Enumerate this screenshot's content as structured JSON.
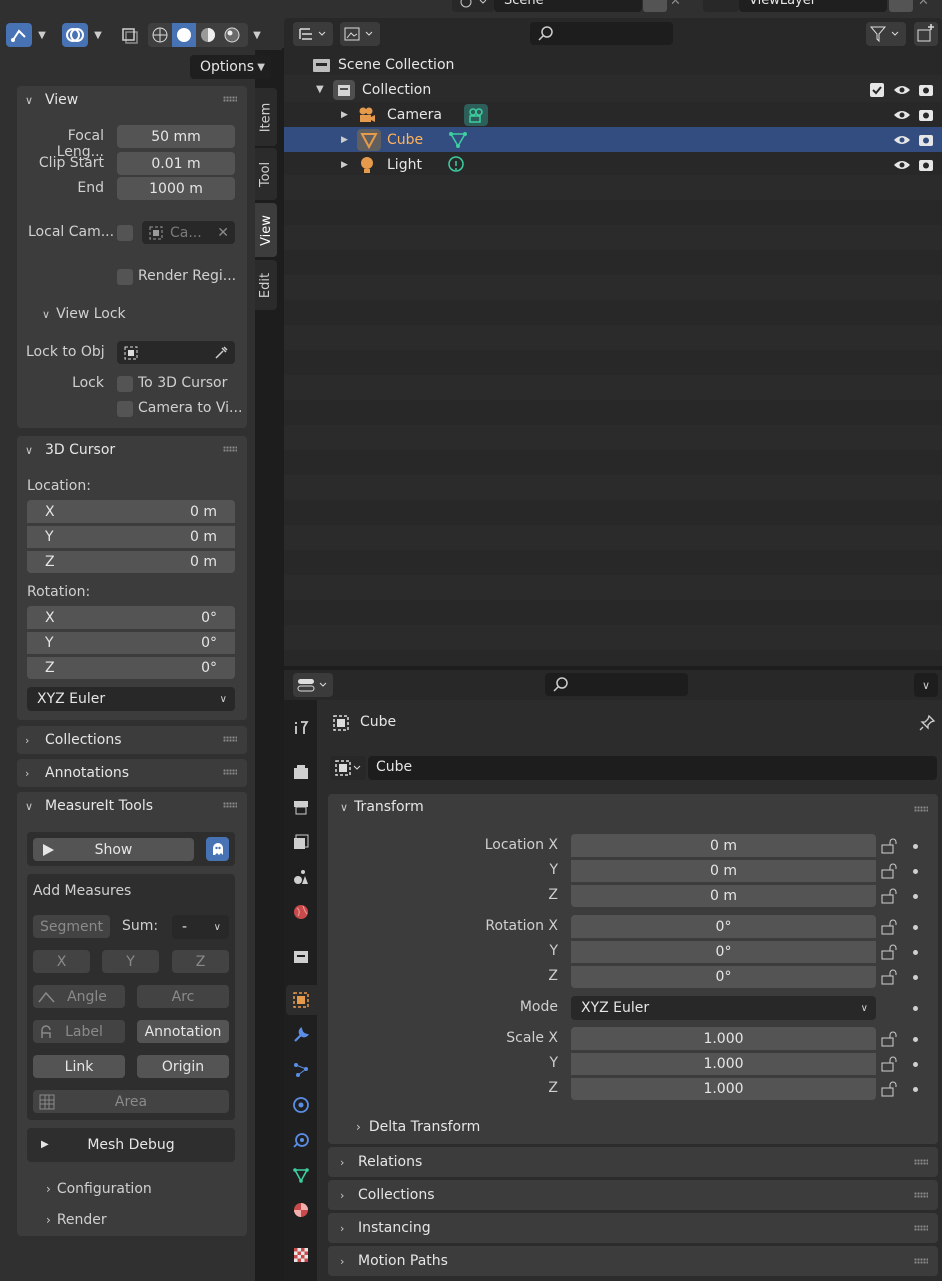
{
  "viewport": {
    "options_label": "Options"
  },
  "side_tabs": [
    "Item",
    "Tool",
    "View",
    "Edit"
  ],
  "view_panel": {
    "title": "View",
    "focal_length_label": "Focal Leng...",
    "focal_length_value": "50 mm",
    "clip_start_label": "Clip Start",
    "clip_start_value": "0.01 m",
    "clip_end_label": "End",
    "clip_end_value": "1000 m",
    "local_camera_label": "Local Cam...",
    "local_camera_field": "Ca...",
    "render_region_label": "Render Regi...",
    "view_lock_title": "View Lock",
    "lock_to_obj_label": "Lock to Obj",
    "lock_label": "Lock",
    "to_3d_cursor_label": "To 3D Cursor",
    "camera_to_view_label": "Camera to Vi..."
  },
  "cursor_panel": {
    "title": "3D Cursor",
    "location_label": "Location:",
    "location": [
      {
        "axis": "X",
        "value": "0 m"
      },
      {
        "axis": "Y",
        "value": "0 m"
      },
      {
        "axis": "Z",
        "value": "0 m"
      }
    ],
    "rotation_label": "Rotation:",
    "rotation": [
      {
        "axis": "X",
        "value": "0°"
      },
      {
        "axis": "Y",
        "value": "0°"
      },
      {
        "axis": "Z",
        "value": "0°"
      }
    ],
    "rotation_mode": "XYZ Euler"
  },
  "collapsed_panels": {
    "collections": "Collections",
    "annotations": "Annotations"
  },
  "measureit": {
    "title": "MeasureIt Tools",
    "show_label": "Show",
    "add_measures_title": "Add Measures",
    "segment_label": "Segment",
    "sum_label": "Sum:",
    "sum_value": "-",
    "x_label": "X",
    "y_label": "Y",
    "z_label": "Z",
    "angle_label": "Angle",
    "arc_label": "Arc",
    "label_label": "Label",
    "annotation_label": "Annotation",
    "link_label": "Link",
    "origin_label": "Origin",
    "area_label": "Area",
    "mesh_debug_label": "Mesh Debug",
    "configuration_label": "Configuration",
    "render_label": "Render"
  },
  "top_bar": {
    "scene_name": "Scene",
    "view_layer_name": "ViewLayer"
  },
  "outliner": {
    "scene_collection": "Scene Collection",
    "collection": "Collection",
    "items": [
      {
        "name": "Camera",
        "selected": false
      },
      {
        "name": "Cube",
        "selected": true
      },
      {
        "name": "Light",
        "selected": false
      }
    ]
  },
  "properties": {
    "object_name_header": "Cube",
    "object_name_field": "Cube",
    "transform_title": "Transform",
    "location_x_label": "Location X",
    "location_x": "0 m",
    "location_y_label": "Y",
    "location_y": "0 m",
    "location_z_label": "Z",
    "location_z": "0 m",
    "rotation_x_label": "Rotation X",
    "rotation_x": "0°",
    "rotation_y_label": "Y",
    "rotation_y": "0°",
    "rotation_z_label": "Z",
    "rotation_z": "0°",
    "mode_label": "Mode",
    "mode_value": "XYZ Euler",
    "scale_x_label": "Scale X",
    "scale_x": "1.000",
    "scale_y_label": "Y",
    "scale_y": "1.000",
    "scale_z_label": "Z",
    "scale_z": "1.000",
    "delta_transform": "Delta Transform",
    "relations": "Relations",
    "collections": "Collections",
    "instancing": "Instancing",
    "motion_paths": "Motion Paths"
  },
  "colors": {
    "accent_blue": "#4772b3",
    "selection_blue": "#334d80",
    "object_orange": "#e69a4c",
    "data_green": "#3ccfa0"
  }
}
